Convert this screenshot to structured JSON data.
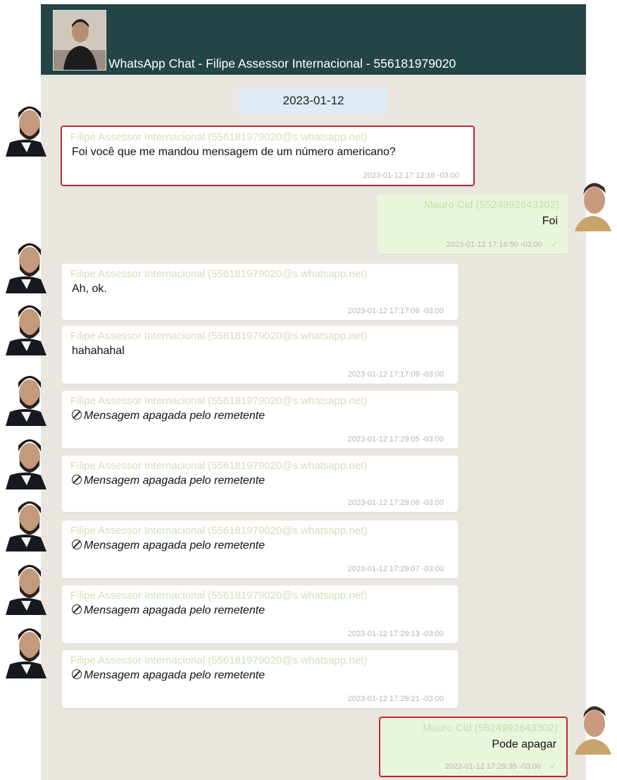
{
  "header": {
    "title": "WhatsApp Chat - Filipe Assessor Internacional - 556181979020",
    "avatar_icon": "contact-avatar-photo"
  },
  "date_chip": "2023-01-12",
  "messages": [
    {
      "dir": "in",
      "sender": "Filipe Assessor Internacional (556181979020@s.whatsapp.net)",
      "text": "Foi você que me mandou mensagem de um número americano?",
      "time": "2023-01-12 17:12:18 -03:00",
      "highlighted": true,
      "deleted": false
    },
    {
      "dir": "out",
      "sender": "Mauro Cid (5524992643302)",
      "text": "Foi",
      "time": "2023-01-12 17:16:50 -03:00",
      "highlighted": false,
      "deleted": false
    },
    {
      "dir": "in",
      "sender": "Filipe Assessor Internacional (556181979020@s.whatsapp.net)",
      "text": "Ah, ok.",
      "time": "2023-01-12 17:17:06 -03:00",
      "highlighted": false,
      "deleted": false
    },
    {
      "dir": "in",
      "sender": "Filipe Assessor Internacional (556181979020@s.whatsapp.net)",
      "text": "hahahahal",
      "time": "2023-01-12 17:17:09 -03:00",
      "highlighted": false,
      "deleted": false
    },
    {
      "dir": "in",
      "sender": "Filipe Assessor Internacional (556181979020@s.whatsapp.net)",
      "text": "Mensagem apagada pelo remetente",
      "time": "2023-01-12 17:29:05 -03:00",
      "highlighted": false,
      "deleted": true
    },
    {
      "dir": "in",
      "sender": "Filipe Assessor Internacional (556181979020@s.whatsapp.net)",
      "text": "Mensagem apagada pelo remetente",
      "time": "2023-01-12 17:29:06 -03:00",
      "highlighted": false,
      "deleted": true
    },
    {
      "dir": "in",
      "sender": "Filipe Assessor Internacional (556181979020@s.whatsapp.net)",
      "text": "Mensagem apagada pelo remetente",
      "time": "2023-01-12 17:29:07 -03:00",
      "highlighted": false,
      "deleted": true
    },
    {
      "dir": "in",
      "sender": "Filipe Assessor Internacional (556181979020@s.whatsapp.net)",
      "text": "Mensagem apagada pelo remetente",
      "time": "2023-01-12 17:29:13 -03:00",
      "highlighted": false,
      "deleted": true
    },
    {
      "dir": "in",
      "sender": "Filipe Assessor Internacional (556181979020@s.whatsapp.net)",
      "text": "Mensagem apagada pelo remetente",
      "time": "2023-01-12 17:29:21 -03:00",
      "highlighted": false,
      "deleted": true
    },
    {
      "dir": "out",
      "sender": "Mauro Cid (5524992643302)",
      "text": "Pode apagar",
      "time": "2023-01-12 17:29:35 -03:00",
      "highlighted": true,
      "deleted": false
    }
  ],
  "colors": {
    "header_bg": "#234545",
    "chat_bg": "#e9e6e0",
    "incoming_bubble": "#ffffff",
    "outgoing_bubble": "#e9f6dc",
    "highlight_border": "#c0282f",
    "date_chip_bg": "#dcebf4"
  },
  "icons": {
    "deleted": "ban-icon",
    "delivered": "check-icon"
  }
}
